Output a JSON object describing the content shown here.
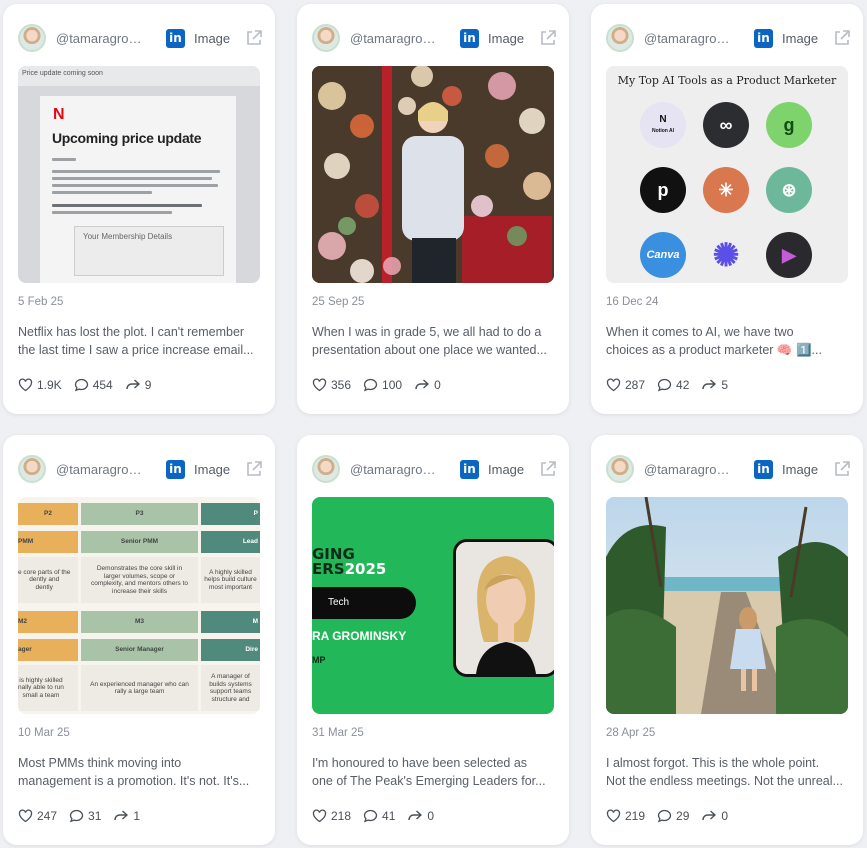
{
  "cards": [
    {
      "handle": "@tamaragrominsky",
      "type_label": "Image",
      "date": "5 Feb 25",
      "caption_line1": "Netflix has lost the plot. I can't remember",
      "caption_line2": "the last time I saw a price increase email...",
      "likes": "1.9K",
      "comments": "454",
      "reposts": "9",
      "thumb": {
        "kind": "email",
        "topbar": "Price update coming soon",
        "logo": "N",
        "headline": "Upcoming price update",
        "box_label": "Your Membership Details"
      }
    },
    {
      "handle": "@tamaragrominsky",
      "type_label": "Image",
      "date": "25 Sep 25",
      "caption_line1": "When I was in grade 5, we all had to do a",
      "caption_line2": "presentation about one place we wanted...",
      "likes": "356",
      "comments": "100",
      "reposts": "0",
      "thumb": {
        "kind": "flowers"
      }
    },
    {
      "handle": "@tamaragrominsky",
      "type_label": "Image",
      "date": "16 Dec 24",
      "caption_line1": "When it comes to AI, we have two",
      "caption_line2": "choices as a product marketer 🧠 1️⃣...",
      "likes": "287",
      "comments": "42",
      "reposts": "5",
      "thumb": {
        "kind": "ai-tools",
        "title": "My Top AI Tools as a Product Marketer",
        "tools": [
          {
            "label": "N",
            "sub": "Notion AI",
            "color": "#e6e3f3",
            "fg": "#111"
          },
          {
            "label": "∞",
            "color": "#2b2d31",
            "fg": "#fff"
          },
          {
            "label": "g",
            "color": "#7ed36c",
            "fg": "#124d14"
          },
          {
            "label": "p",
            "color": "#111111",
            "fg": "#fff"
          },
          {
            "label": "✳",
            "color": "#d9774f",
            "fg": "#fff"
          },
          {
            "label": "⊛",
            "color": "#6db89a",
            "fg": "#fff"
          },
          {
            "label": "Canva",
            "color": "#3b8fe0",
            "fg": "#fff"
          },
          {
            "label": "✺",
            "color": "#eeeeef",
            "fg": "#5a50e6"
          },
          {
            "label": "▶",
            "color": "#2a2a2e",
            "fg": "#c65bd9"
          }
        ]
      }
    },
    {
      "handle": "@tamaragrominsky",
      "type_label": "Image",
      "date": "10 Mar 25",
      "caption_line1": "Most PMMs think moving into",
      "caption_line2": "management is a promotion. It's not. It's...",
      "likes": "247",
      "comments": "31",
      "reposts": "1",
      "thumb": {
        "kind": "table",
        "r1": [
          "P2",
          "P3",
          "P"
        ],
        "r2": [
          "PMM",
          "Senior PMM",
          "Lead"
        ],
        "r3": [
          "e core parts of the\ndently and\ndently",
          "Demonstrates the core skill in\nlarger volumes, scope or\ncomplexity, and mentors others to\nincrease their skills",
          "A highly skilled\nhelps build culture\nmost important"
        ],
        "r4": [
          "M2",
          "M3",
          "M"
        ],
        "r5": [
          "ager",
          "Senior Manager",
          "Dire"
        ],
        "r6": [
          "is highly skilled\nnally able to run\nsmall a team",
          "An experienced manager who can\nrally a large team",
          "A manager of\nbuilds systems\nsupport teams\nstructure and"
        ]
      }
    },
    {
      "handle": "@tamaragrominsky",
      "type_label": "Image",
      "date": "31 Mar 25",
      "caption_line1": "I'm honoured to have been selected as",
      "caption_line2": "one of The Peak's Emerging Leaders for...",
      "likes": "218",
      "comments": "41",
      "reposts": "0",
      "thumb": {
        "kind": "award",
        "line1": "GING",
        "line2": "ERS",
        "year": "2025",
        "pill": "Tech",
        "name": "RA GROMINSKY",
        "sub": "MP"
      }
    },
    {
      "handle": "@tamaragrominsky",
      "type_label": "Image",
      "date": "28 Apr 25",
      "caption_line1": "I almost forgot. This is the whole point.",
      "caption_line2": "Not the endless meetings. Not the unreal...",
      "likes": "219",
      "comments": "29",
      "reposts": "0",
      "thumb": {
        "kind": "beach"
      }
    }
  ],
  "colors": {
    "linkedin": "#0a66c2",
    "card_bg": "#ffffff",
    "page_bg": "#eef0f3"
  }
}
